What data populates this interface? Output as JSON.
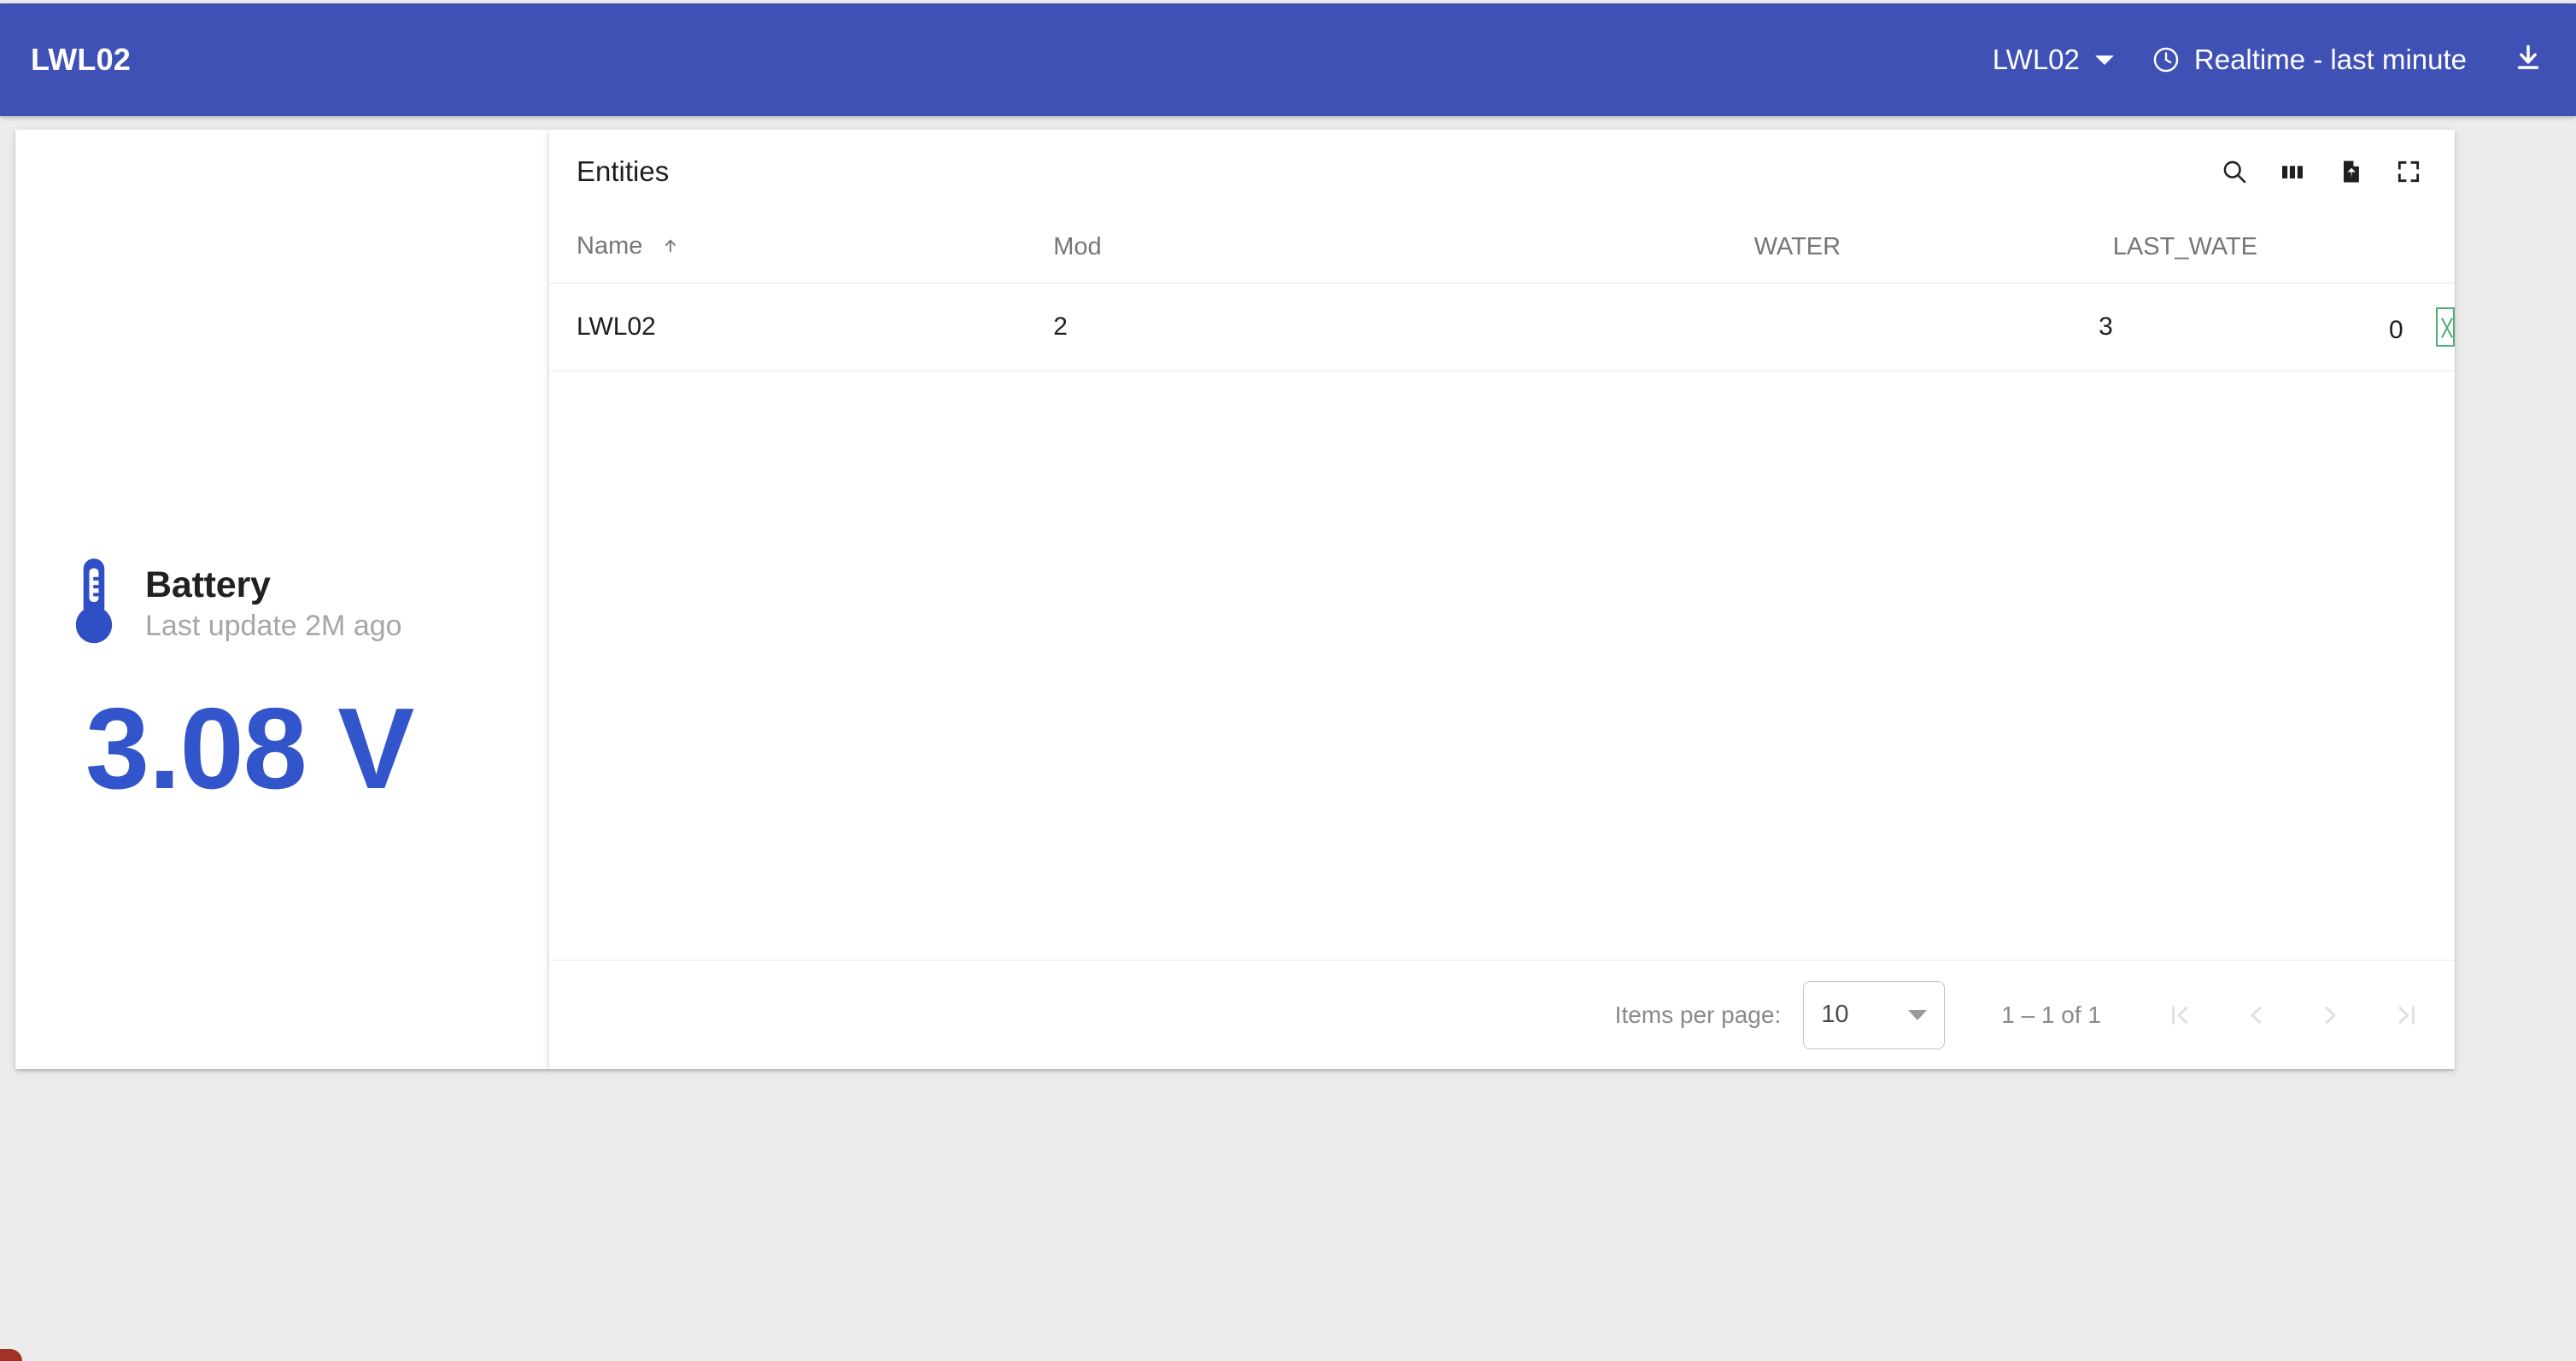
{
  "appbar": {
    "title": "LWL02",
    "device_selector": {
      "label": "LWL02",
      "icon": "chevron-down-icon"
    },
    "time_range": {
      "label": "Realtime - last minute",
      "icon": "clock-icon"
    },
    "download": {
      "icon": "download-icon"
    },
    "background_color": "#3f51b5",
    "text_color": "#ffffff"
  },
  "battery_card": {
    "icon": "thermometer-icon",
    "icon_color": "#2f4fc4",
    "title": "Battery",
    "subtitle": "Last update 2M ago",
    "value": "3.08 V",
    "value_color": "#3355cc"
  },
  "entities_card": {
    "title": "Entities",
    "tools": [
      {
        "name": "search-icon",
        "label": "Search"
      },
      {
        "name": "columns-icon",
        "label": "Columns"
      },
      {
        "name": "file-export-icon",
        "label": "Export"
      },
      {
        "name": "fullscreen-icon",
        "label": "Fullscreen"
      }
    ],
    "table": {
      "columns": [
        {
          "key": "name",
          "label": "Name",
          "sorted": "asc",
          "sort_icon": "arrow-up-icon"
        },
        {
          "key": "mod",
          "label": "Mod"
        },
        {
          "key": "water",
          "label": "WATER"
        },
        {
          "key": "last_water",
          "label": "LAST_WATE"
        }
      ],
      "rows": [
        {
          "name": "LWL02",
          "mod": "2",
          "water": "3",
          "last_water": "0",
          "status_glyph": "missing-glyph-box"
        }
      ]
    },
    "paginator": {
      "items_per_page_label": "Items per page:",
      "items_per_page_value": "10",
      "range_label": "1 – 1 of 1",
      "buttons": [
        {
          "name": "first-page-button",
          "glyph": "|<",
          "disabled": true
        },
        {
          "name": "previous-page-button",
          "glyph": "<",
          "disabled": true
        },
        {
          "name": "next-page-button",
          "glyph": ">",
          "disabled": true
        },
        {
          "name": "last-page-button",
          "glyph": ">|",
          "disabled": true
        }
      ]
    }
  }
}
